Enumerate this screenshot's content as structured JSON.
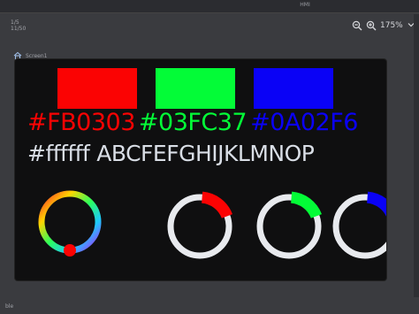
{
  "window": {
    "title": "HMI"
  },
  "stats": {
    "line1": "1/5",
    "line2": "11/50"
  },
  "zoom": {
    "level": "175%"
  },
  "breadcrumb": {
    "screen": "Screen1"
  },
  "swatches": [
    {
      "name": "red",
      "color": "#FB0303"
    },
    {
      "name": "green",
      "color": "#03FC37"
    },
    {
      "name": "blue",
      "color": "#0A02F6"
    }
  ],
  "hex_labels": [
    {
      "text": "#FB0303",
      "color": "#FB0303"
    },
    {
      "text": "#03FC37",
      "color": "#03FC37"
    },
    {
      "text": "#0A02F6",
      "color": "#0A02F6"
    }
  ],
  "white_label": {
    "text": "#ffffff"
  },
  "alphabet": {
    "text": "ABCFEFGHIJKLMNOP"
  },
  "dials": [
    {
      "name": "hue-wheel",
      "type": "hue",
      "knob_color": "#FB0303"
    },
    {
      "name": "red-ring",
      "color": "#FB0303",
      "level": 0.18
    },
    {
      "name": "green-ring",
      "color": "#03FC37",
      "level": 0.18
    },
    {
      "name": "blue-ring",
      "color": "#0A02F6",
      "level": 0.18
    }
  ],
  "status": {
    "bottom_left": "ble"
  }
}
